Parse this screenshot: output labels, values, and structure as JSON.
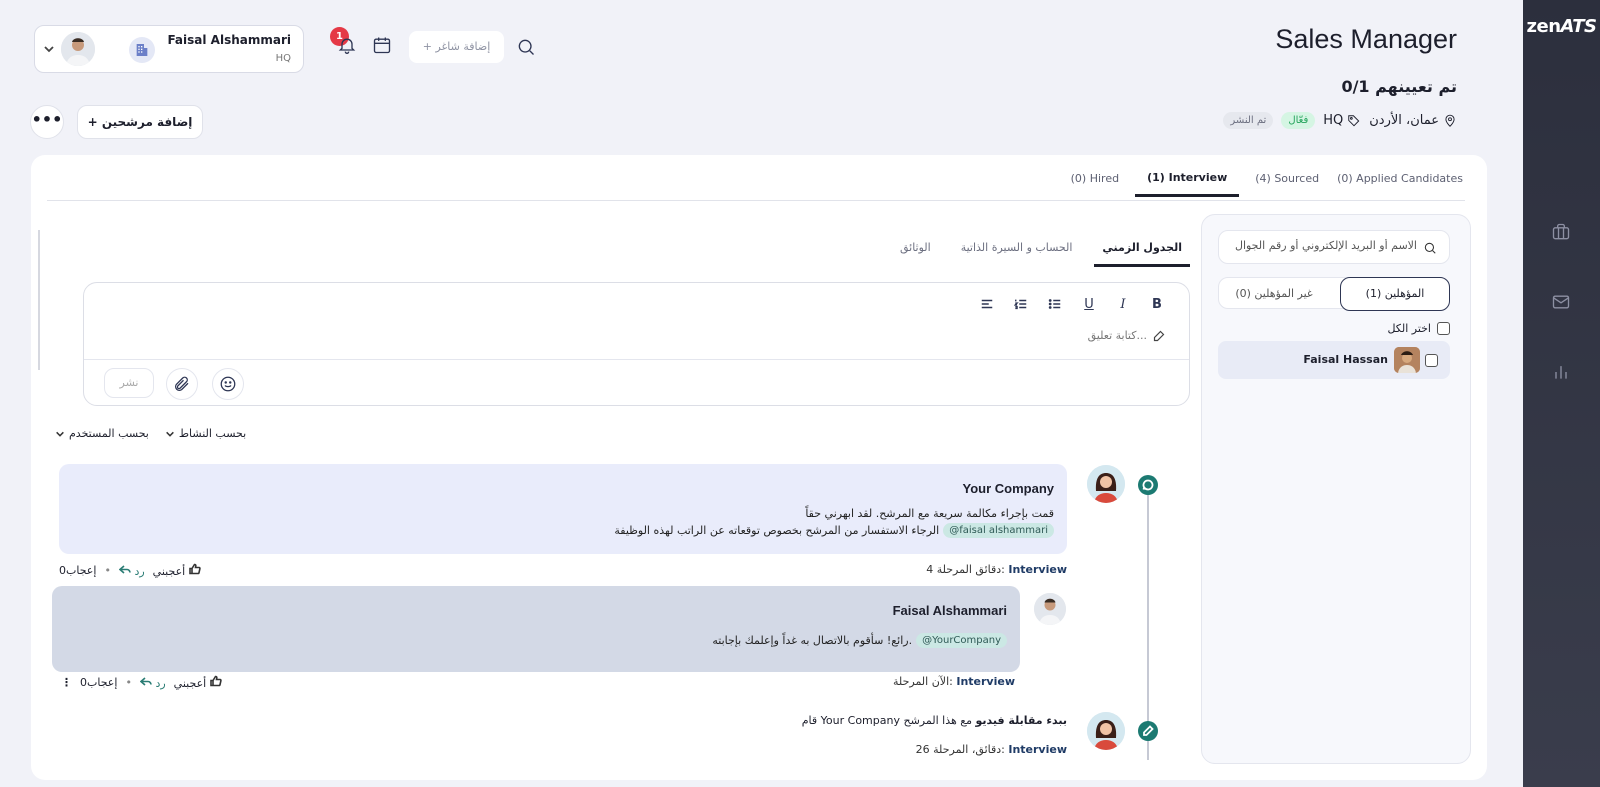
{
  "brand": {
    "logo_a": "zen",
    "logo_b": "ATS"
  },
  "header": {
    "title": "Sales Manager",
    "assigned": "0/1 تم تعيينهم",
    "location": "عمان، الأردن",
    "branch": "HQ",
    "badge_active": "فعّال",
    "badge_posted": "تم النشر"
  },
  "user": {
    "name": "Faisal Alshammari",
    "location": "HQ"
  },
  "notifications": {
    "count": "1"
  },
  "topbar": {
    "add_vacancy": "+ إضافة شاغر"
  },
  "actions": {
    "add_candidates": "+ إضافة مرشحين",
    "more": "•••"
  },
  "pipeline_tabs": [
    {
      "label": "(0) Applied Candidates"
    },
    {
      "label": "(4) Sourced"
    },
    {
      "label": "(1) Interview"
    },
    {
      "label": "(0) Hired"
    }
  ],
  "candidates": {
    "search_placeholder": "الاسم أو البريد الإلكتروني أو رقم الجوال",
    "qualified": "المؤهلين (1)",
    "unqualified": "غير المؤهلين (0)",
    "select_all": "اختر الكل",
    "list": [
      {
        "name": "Faisal Hassan"
      }
    ]
  },
  "subtabs": {
    "timeline": "الجدول الزمني",
    "profile": "الحساب و السيرة الذاتية",
    "documents": "الوثائق"
  },
  "editor": {
    "placeholder": "كتابة تعليق...",
    "post": "نشر"
  },
  "filters": {
    "by_user": "بحسب المستخدم",
    "by_activity": "بحسب النشاط"
  },
  "timeline": [
    {
      "author": "Your Company",
      "line1": "قمت بإجراء مكالمة سريعة مع المرشح. لقد ابهرني حقاً",
      "mention": "@faisal alshammari",
      "line2": "الرجاء الاستفسار من المرشح بخصوص توقعاته عن الراتب لهذه الوظيفة",
      "time": "4 دقائق",
      "stage_label": "المرحلة:",
      "stage": "Interview",
      "like": "أعجبني",
      "reply": "رد",
      "likes": "0إعجاب"
    },
    {
      "author": "Faisal Alshammari",
      "mention": "@YourCompany",
      "line1": "رائع! سأقوم بالاتصال به غداً وإعلمك بإجابته.",
      "time": "الآن",
      "stage_label": "المرحلة:",
      "stage": "Interview",
      "like": "أعجبني",
      "reply": "رد",
      "likes": "0إعجاب"
    },
    {
      "prefix": "قام Your Company",
      "bold": "ببدء مقابلة فيديو",
      "suffix": "مع هذا المرشح",
      "time": "26 دقائق،",
      "stage_label": "المرحلة:",
      "stage": "Interview"
    }
  ]
}
